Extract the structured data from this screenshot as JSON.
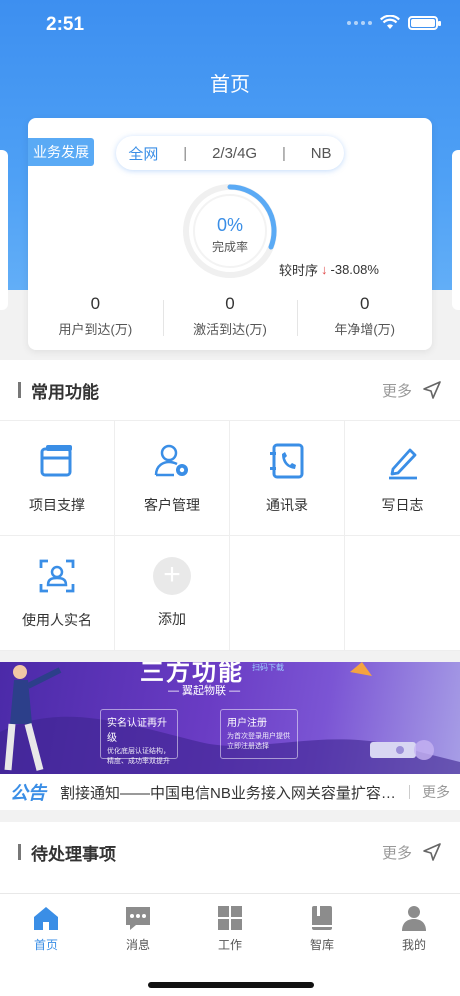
{
  "status": {
    "time": "2:51"
  },
  "header": {
    "title": "首页"
  },
  "business_card": {
    "tag": "业务发展",
    "tabs": [
      {
        "label": "全网",
        "active": true
      },
      {
        "label": "2/3/4G",
        "active": false
      },
      {
        "label": "NB",
        "active": false
      }
    ],
    "completion": {
      "value": "0%",
      "label": "完成率",
      "progress_percent": 0
    },
    "compare": {
      "label": "较时序",
      "direction": "down",
      "value": "-38.08%"
    },
    "stats": [
      {
        "value": "0",
        "label": "用户到达(万)"
      },
      {
        "value": "0",
        "label": "激活到达(万)"
      },
      {
        "value": "0",
        "label": "年净增(万)"
      }
    ]
  },
  "common_functions": {
    "title": "常用功能",
    "more_label": "更多",
    "items": [
      {
        "label": "项目支撑",
        "icon": "project-window-icon"
      },
      {
        "label": "客户管理",
        "icon": "customer-gear-icon"
      },
      {
        "label": "通讯录",
        "icon": "contacts-phone-icon"
      },
      {
        "label": "写日志",
        "icon": "pencil-icon"
      },
      {
        "label": "使用人实名",
        "icon": "face-scan-icon"
      },
      {
        "label": "添加",
        "icon": "plus-icon"
      }
    ]
  },
  "banner": {
    "heading": "三方功能",
    "sub": "— 翼起物联 —",
    "logo": "扫码下载",
    "box1": {
      "title": "实名认证再升级",
      "text": "优化底层认证结构，精度、成功率双提升"
    },
    "box2": {
      "title": "用户注册",
      "text": "为首次登录用户提供立即注册选择"
    }
  },
  "notice": {
    "tag": "公告",
    "text": "割接通知——中国电信NB业务接入网关容量扩容割接通知",
    "more_label": "更多"
  },
  "pending": {
    "title": "待处理事项",
    "more_label": "更多"
  },
  "tabbar": {
    "items": [
      {
        "label": "首页",
        "icon": "home-icon",
        "active": true
      },
      {
        "label": "消息",
        "icon": "message-icon",
        "active": false
      },
      {
        "label": "工作",
        "icon": "grid-icon",
        "active": false
      },
      {
        "label": "智库",
        "icon": "book-icon",
        "active": false
      },
      {
        "label": "我的",
        "icon": "person-icon",
        "active": false
      }
    ]
  },
  "colors": {
    "accent": "#3a8ee6",
    "header": "#4ea0f5",
    "down": "#e04848"
  }
}
